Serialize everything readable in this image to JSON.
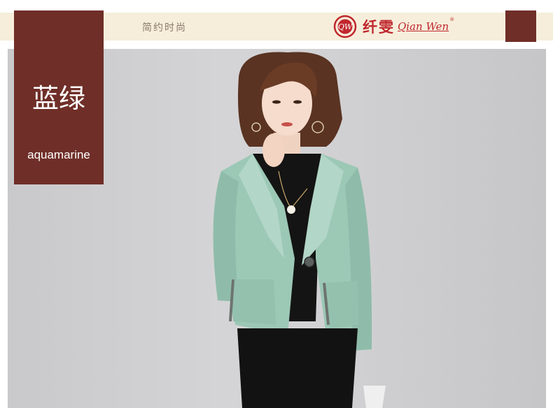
{
  "header": {
    "tagline": "简约时尚",
    "brand_cn": "纤雯",
    "brand_en": "Qian Wen",
    "brand_reg": "®",
    "logo_icon": "qw-circle-logo-icon"
  },
  "color_card": {
    "name_cn": "蓝绿",
    "name_en": "aquamarine",
    "bg": "#6f2e28"
  },
  "colors": {
    "band": "#f6eedb",
    "brand_red": "#c0272d",
    "swatch": "#6f2e28",
    "coat": "#9cc8b6"
  }
}
